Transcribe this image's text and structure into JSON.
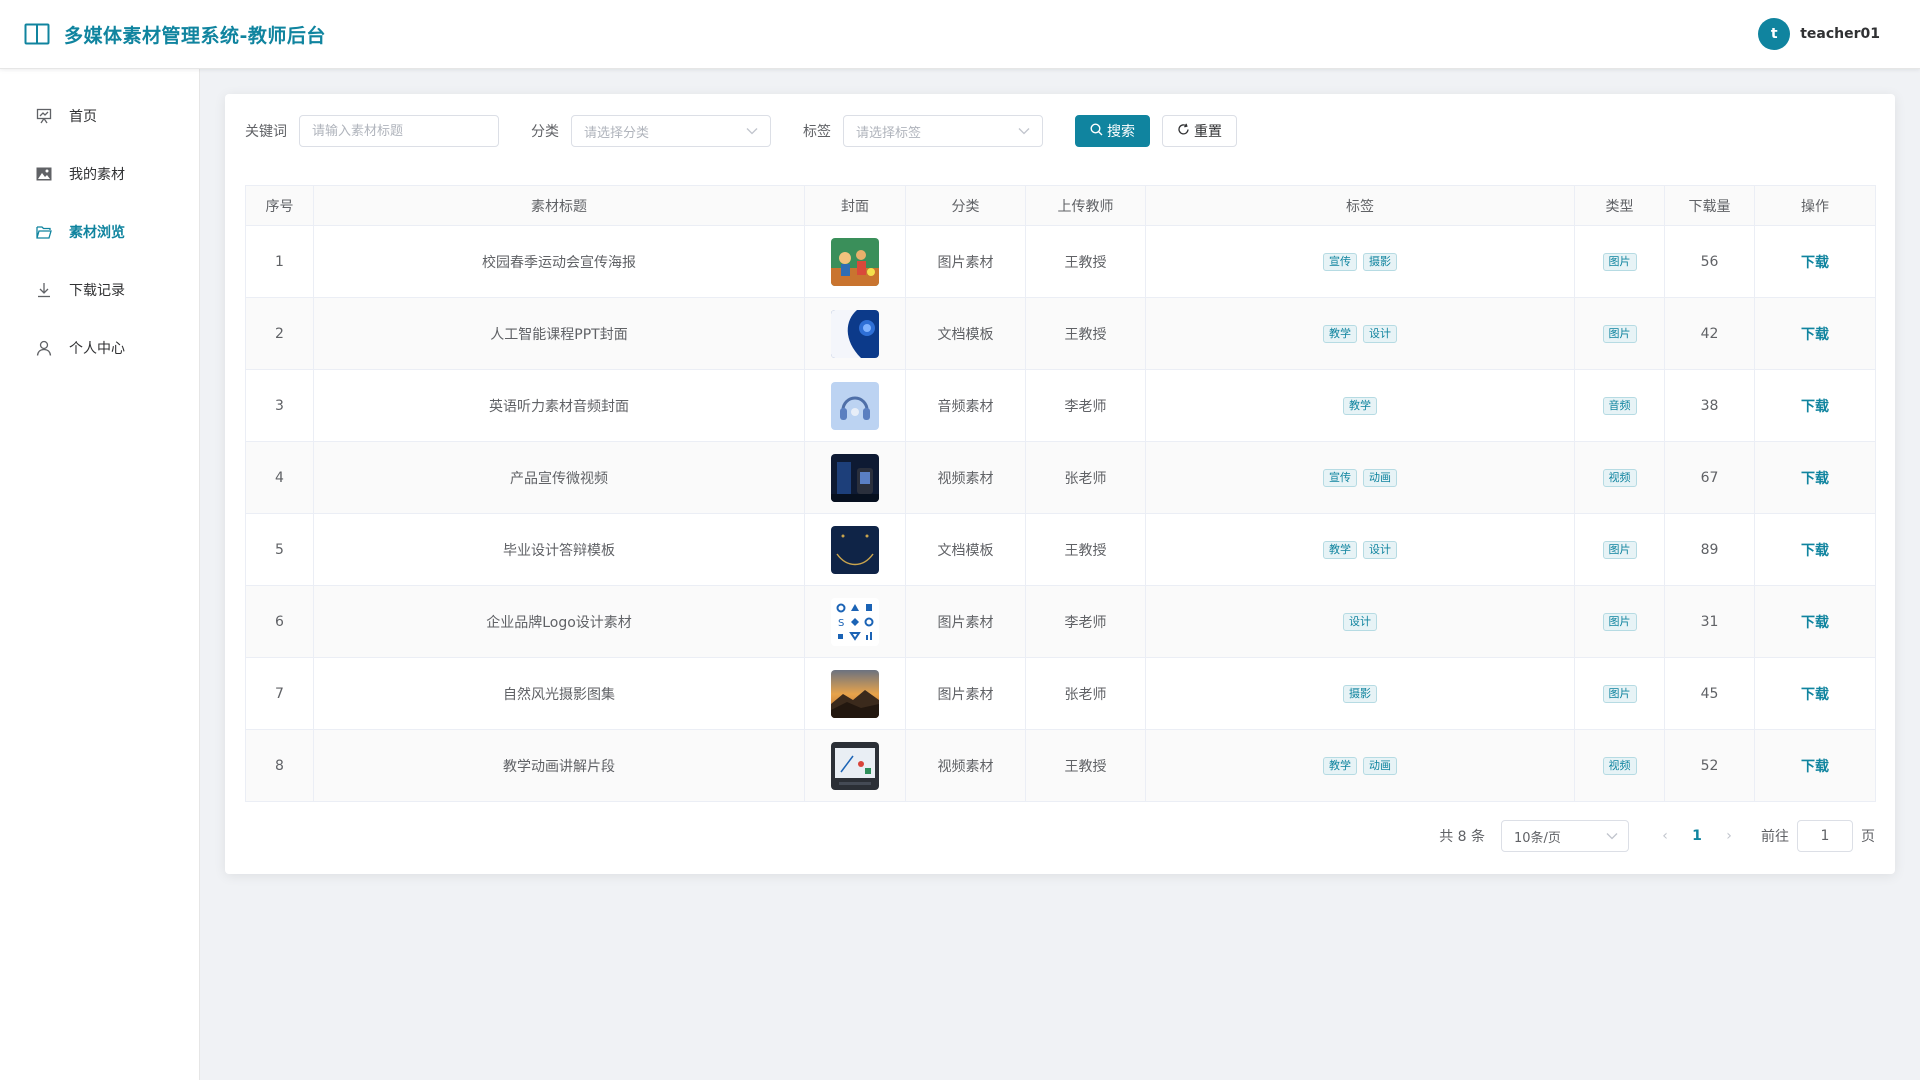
{
  "header": {
    "title": "多媒体素材管理系统-教师后台",
    "user": {
      "avatar_letter": "t",
      "name": "teacher01"
    }
  },
  "sidebar": {
    "items": [
      {
        "label": "首页",
        "icon": "presentation-icon",
        "active": false
      },
      {
        "label": "我的素材",
        "icon": "image-icon",
        "active": false
      },
      {
        "label": "素材浏览",
        "icon": "folder-open-icon",
        "active": true
      },
      {
        "label": "下载记录",
        "icon": "download-icon",
        "active": false
      },
      {
        "label": "个人中心",
        "icon": "user-icon",
        "active": false
      }
    ]
  },
  "search": {
    "keyword_label": "关键词",
    "keyword_placeholder": "请输入素材标题",
    "category_label": "分类",
    "category_placeholder": "请选择分类",
    "tag_label": "标签",
    "tag_placeholder": "请选择标签",
    "search_button": "搜索",
    "reset_button": "重置"
  },
  "table": {
    "columns": [
      "序号",
      "素材标题",
      "封面",
      "分类",
      "上传教师",
      "标签",
      "类型",
      "下载量",
      "操作"
    ],
    "action_label": "下载",
    "rows": [
      {
        "index": "1",
        "title": "校园春季运动会宣传海报",
        "category": "图片素材",
        "teacher": "王教授",
        "tags": [
          "宣传",
          "摄影"
        ],
        "type": "图片",
        "downloads": "56",
        "cover": "sports"
      },
      {
        "index": "2",
        "title": "人工智能课程PPT封面",
        "category": "文档模板",
        "teacher": "王教授",
        "tags": [
          "教学",
          "设计"
        ],
        "type": "图片",
        "downloads": "42",
        "cover": "ai"
      },
      {
        "index": "3",
        "title": "英语听力素材音频封面",
        "category": "音频素材",
        "teacher": "李老师",
        "tags": [
          "教学"
        ],
        "type": "音频",
        "downloads": "38",
        "cover": "headphones"
      },
      {
        "index": "4",
        "title": "产品宣传微视频",
        "category": "视频素材",
        "teacher": "张老师",
        "tags": [
          "宣传",
          "动画"
        ],
        "type": "视频",
        "downloads": "67",
        "cover": "product"
      },
      {
        "index": "5",
        "title": "毕业设计答辩模板",
        "category": "文档模板",
        "teacher": "王教授",
        "tags": [
          "教学",
          "设计"
        ],
        "type": "图片",
        "downloads": "89",
        "cover": "navy"
      },
      {
        "index": "6",
        "title": "企业品牌Logo设计素材",
        "category": "图片素材",
        "teacher": "李老师",
        "tags": [
          "设计"
        ],
        "type": "图片",
        "downloads": "31",
        "cover": "logos"
      },
      {
        "index": "7",
        "title": "自然风光摄影图集",
        "category": "图片素材",
        "teacher": "张老师",
        "tags": [
          "摄影"
        ],
        "type": "图片",
        "downloads": "45",
        "cover": "landscape"
      },
      {
        "index": "8",
        "title": "教学动画讲解片段",
        "category": "视频素材",
        "teacher": "王教授",
        "tags": [
          "教学",
          "动画"
        ],
        "type": "视频",
        "downloads": "52",
        "cover": "screen"
      }
    ]
  },
  "pagination": {
    "total_text": "共 8 条",
    "page_size": "10条/页",
    "current_page": "1",
    "jump_prefix": "前往",
    "jump_value": "1",
    "jump_suffix": "页"
  },
  "colors": {
    "accent": "#10849f"
  }
}
